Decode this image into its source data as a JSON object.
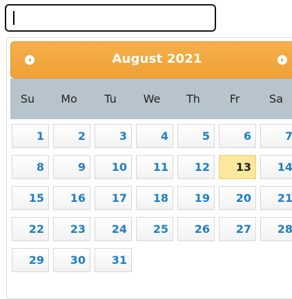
{
  "input": {
    "value": "",
    "placeholder": ""
  },
  "calendar": {
    "month_label": "August 2021",
    "weekdays": [
      "Su",
      "Mo",
      "Tu",
      "We",
      "Th",
      "Fr",
      "Sa"
    ],
    "weeks": [
      [
        "1",
        "2",
        "3",
        "4",
        "5",
        "6",
        "7"
      ],
      [
        "8",
        "9",
        "10",
        "11",
        "12",
        "13",
        "14"
      ],
      [
        "15",
        "16",
        "17",
        "18",
        "19",
        "20",
        "21"
      ],
      [
        "22",
        "23",
        "24",
        "25",
        "26",
        "27",
        "28"
      ],
      [
        "29",
        "30",
        "31"
      ]
    ],
    "highlighted_day": "13"
  },
  "colors": {
    "header_bg": "#f0a83f",
    "weekday_bg": "#b7c4cc",
    "day_text": "#1f7fc4",
    "highlight_bg": "#fbe89c"
  },
  "icons": {
    "prev": "chevron-left-icon",
    "next": "chevron-right-icon"
  }
}
